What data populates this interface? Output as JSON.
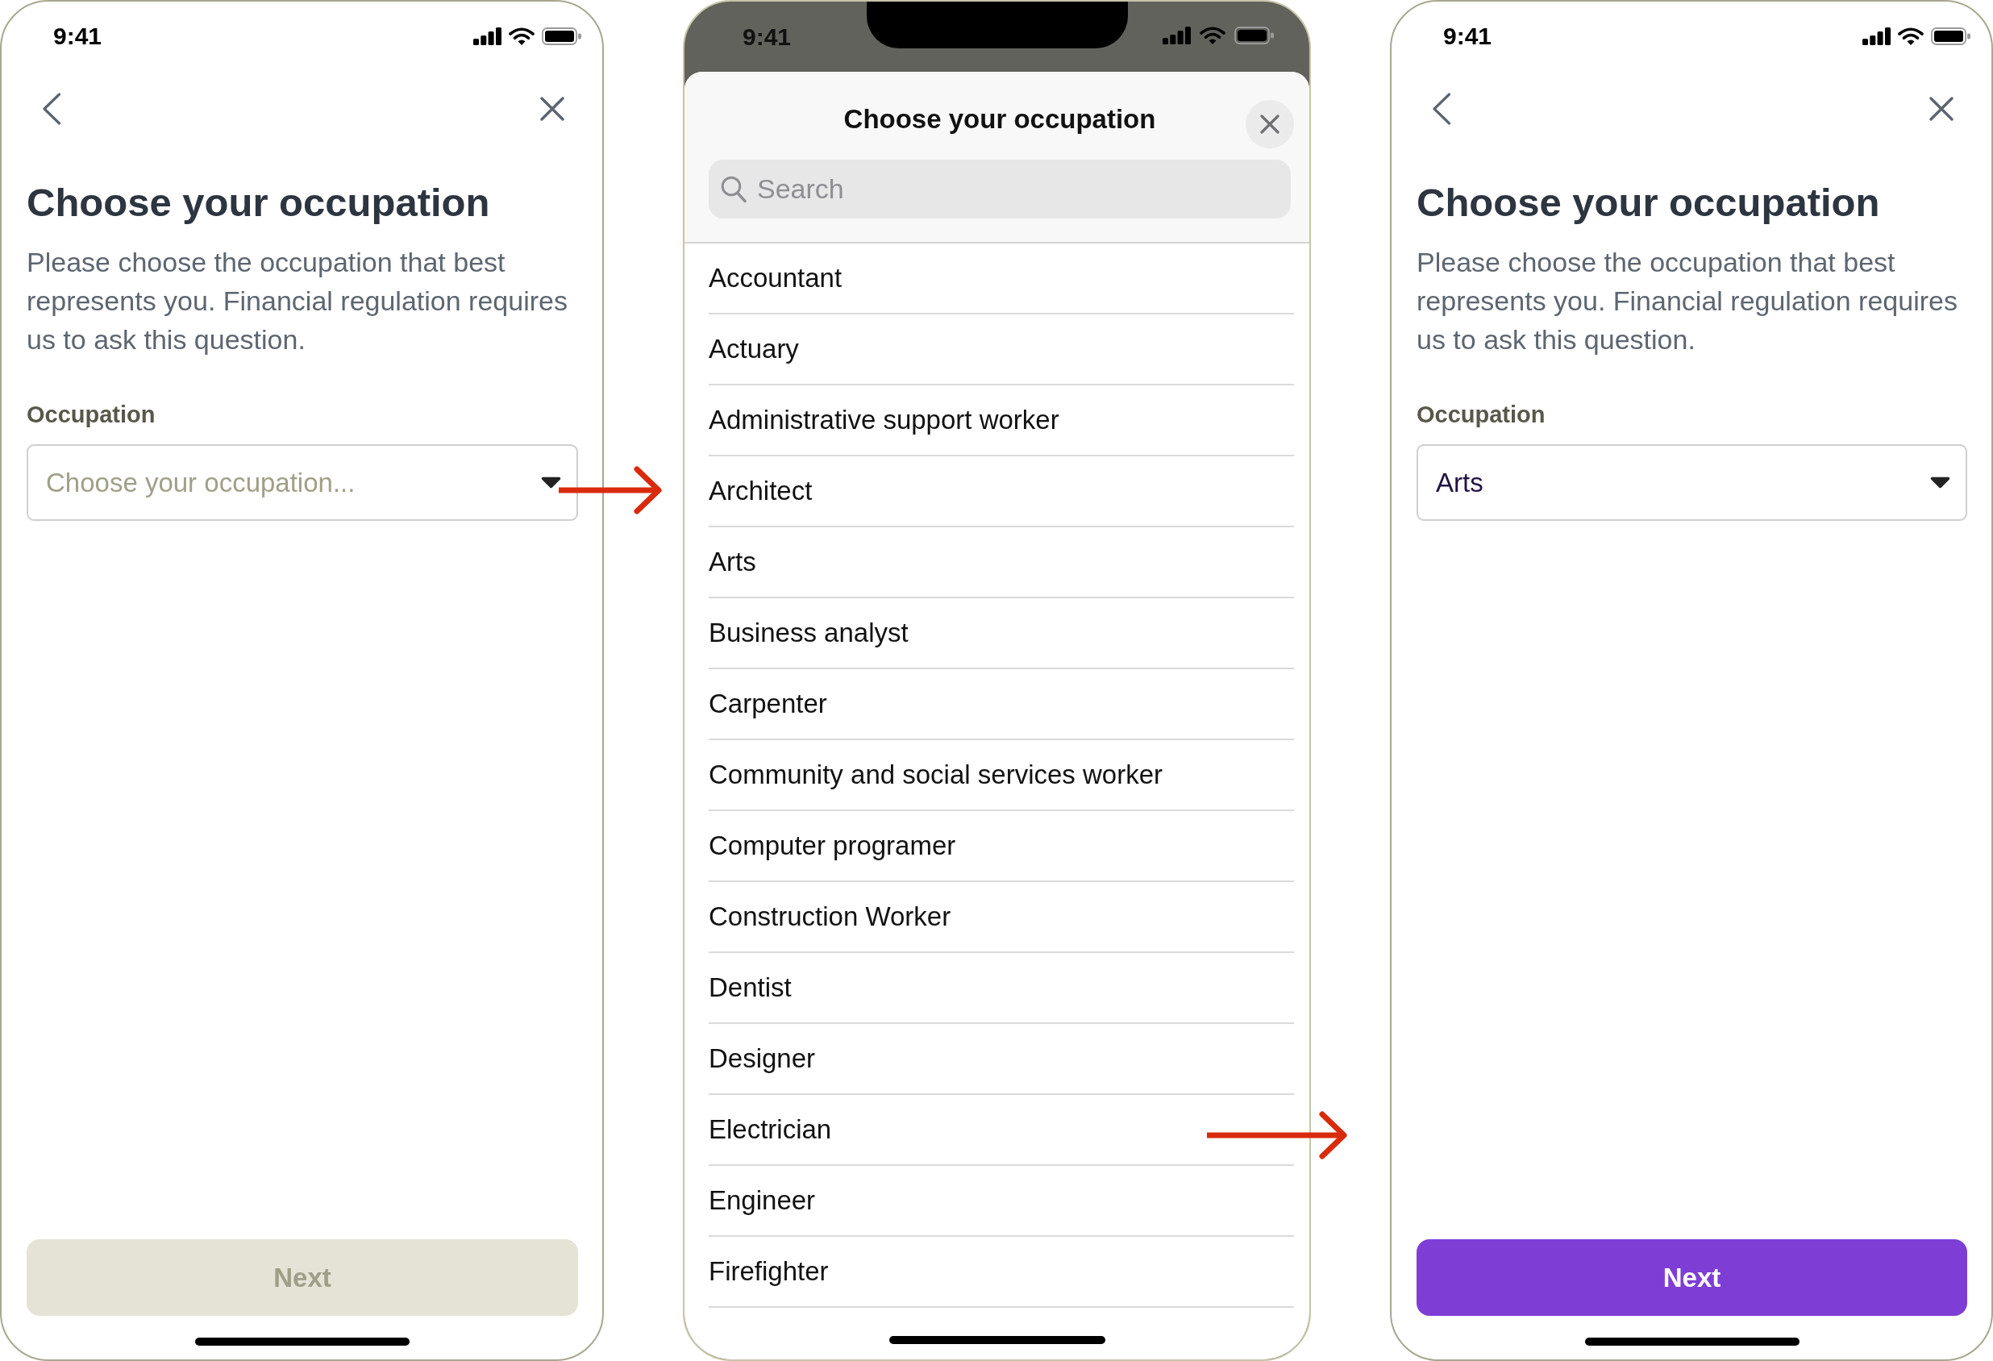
{
  "screens": [
    {
      "kind": "form",
      "status_bar": {
        "time": "9:41"
      },
      "title": "Choose your occupation",
      "description": "Please choose the occupation that best represents you. Financial regulation requires us to ask this question.",
      "field": {
        "label": "Occupation",
        "placeholder": "Choose your occupation..."
      },
      "next_button": {
        "label": "Next",
        "disabled": true
      }
    },
    {
      "kind": "picker",
      "status_bar": {
        "time": "9:41"
      },
      "title": "Choose your occupation",
      "search": {
        "placeholder": "Search"
      },
      "options": [
        "Accountant",
        "Actuary",
        "Administrative support worker",
        "Architect",
        "Arts",
        "Business analyst",
        "Carpenter",
        "Community and social services worker",
        "Computer programer",
        "Construction Worker",
        "Dentist",
        "Designer",
        "Electrician",
        "Engineer",
        "Firefighter"
      ]
    },
    {
      "kind": "form",
      "status_bar": {
        "time": "9:41"
      },
      "title": "Choose your occupation",
      "description": "Please choose the occupation that best represents you. Financial regulation requires us to ask this question.",
      "field": {
        "label": "Occupation",
        "value": "Arts"
      },
      "next_button": {
        "label": "Next",
        "disabled": false
      }
    }
  ]
}
